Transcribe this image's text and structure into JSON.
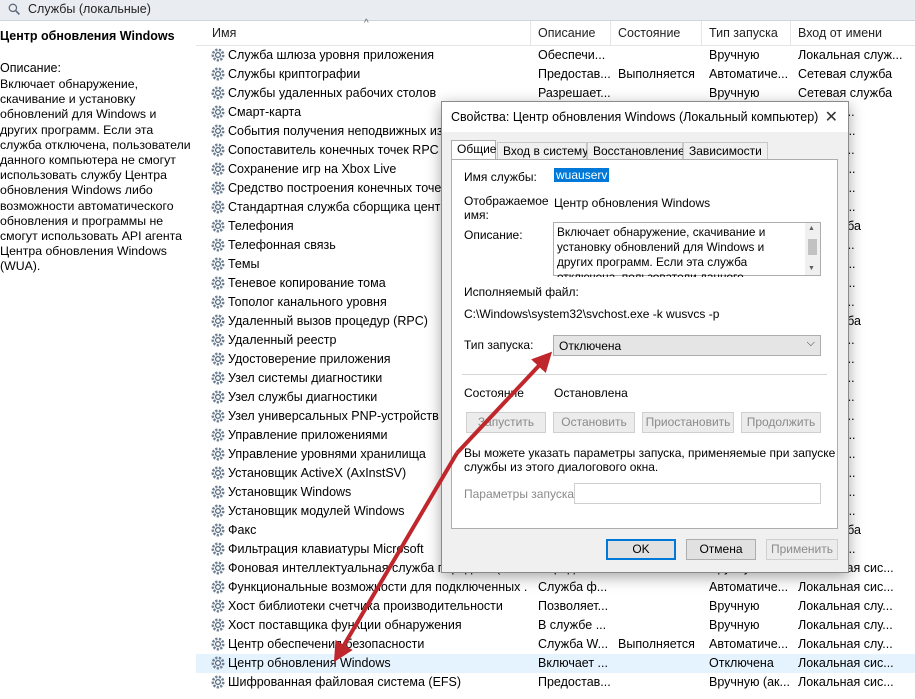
{
  "window_title": "Службы (локальные)",
  "left_pane": {
    "title": "Центр обновления Windows",
    "desc_label": "Описание:",
    "description": "Включает обнаружение, скачивание и установку обновлений для Windows и других программ. Если эта служба отключена, пользователи данного компьютера не смогут использовать службу Центра обновления Windows либо возможности автоматического обновления и программы не смогут использовать API агента Центра обновления Windows (WUA)."
  },
  "columns": [
    "Имя",
    "Описание",
    "Состояние",
    "Тип запуска",
    "Вход от имени"
  ],
  "rows": [
    {
      "name": "Служба шлюза уровня приложения",
      "desc": "Обеспечи...",
      "state": "",
      "type": "Вручную",
      "login": "Локальная служ..."
    },
    {
      "name": "Службы криптографии",
      "desc": "Предостав...",
      "state": "Выполняется",
      "type": "Автоматиче...",
      "login": "Сетевая служба"
    },
    {
      "name": "Службы удаленных рабочих столов",
      "desc": "Разрешает...",
      "state": "",
      "type": "Вручную",
      "login": "Сетевая служба"
    },
    {
      "name": "Смарт-карта",
      "desc": "",
      "state": "",
      "type": "",
      "login": "...ая слу..."
    },
    {
      "name": "События получения неподвижных изо...",
      "desc": "",
      "state": "",
      "type": "",
      "login": "...ая сис..."
    },
    {
      "name": "Сопоставитель конечных точек RPC",
      "desc": "",
      "state": "",
      "type": "",
      "login": "...ая слу..."
    },
    {
      "name": "Сохранение игр на Xbox Live",
      "desc": "",
      "state": "",
      "type": "",
      "login": "...ая сис..."
    },
    {
      "name": "Средство построения конечных точек ...",
      "desc": "",
      "state": "",
      "type": "",
      "login": "...ая сис..."
    },
    {
      "name": "Стандартная служба сборщика центра...",
      "desc": "",
      "state": "",
      "type": "",
      "login": "...ая сис..."
    },
    {
      "name": "Телефония",
      "desc": "",
      "state": "",
      "type": "",
      "login": "...я служба"
    },
    {
      "name": "Телефонная связь",
      "desc": "",
      "state": "",
      "type": "",
      "login": "...ая слу..."
    },
    {
      "name": "Темы",
      "desc": "",
      "state": "",
      "type": "",
      "login": "...ая сис..."
    },
    {
      "name": "Теневое копирование тома",
      "desc": "",
      "state": "",
      "type": "",
      "login": "...ая сис..."
    },
    {
      "name": "Тополог канального уровня",
      "desc": "",
      "state": "",
      "type": "",
      "login": "...ая слу..."
    },
    {
      "name": "Удаленный вызов процедур (RPC)",
      "desc": "",
      "state": "",
      "type": "",
      "login": "...я служба"
    },
    {
      "name": "Удаленный реестр",
      "desc": "",
      "state": "",
      "type": "",
      "login": "...ая слу..."
    },
    {
      "name": "Удостоверение приложения",
      "desc": "",
      "state": "",
      "type": "",
      "login": "...ая слу..."
    },
    {
      "name": "Узел системы диагностики",
      "desc": "",
      "state": "",
      "type": "",
      "login": "...ая слу..."
    },
    {
      "name": "Узел службы диагностики",
      "desc": "",
      "state": "",
      "type": "",
      "login": "...ая слу..."
    },
    {
      "name": "Узел универсальных PNP-устройств",
      "desc": "",
      "state": "",
      "type": "",
      "login": "...ая слу..."
    },
    {
      "name": "Управление приложениями",
      "desc": "",
      "state": "",
      "type": "",
      "login": "...ая сис..."
    },
    {
      "name": "Управление уровнями хранилища",
      "desc": "",
      "state": "",
      "type": "",
      "login": "...ая сис..."
    },
    {
      "name": "Установщик ActiveX (AxInstSV)",
      "desc": "",
      "state": "",
      "type": "",
      "login": "...ая сис..."
    },
    {
      "name": "Установщик Windows",
      "desc": "",
      "state": "",
      "type": "",
      "login": "...ая сис..."
    },
    {
      "name": "Установщик модулей Windows",
      "desc": "",
      "state": "",
      "type": "",
      "login": "...ая сис..."
    },
    {
      "name": "Факс",
      "desc": "",
      "state": "",
      "type": "",
      "login": "...я служба"
    },
    {
      "name": "Фильтрация клавиатуры Microsoft",
      "desc": "",
      "state": "",
      "type": "",
      "login": "...ая сис..."
    },
    {
      "name": "Фоновая интеллектуальная служба передачи (BITS)",
      "desc": "Передает ...",
      "state": "",
      "type": "Вручную",
      "login": "Локальная сис..."
    },
    {
      "name": "Функциональные возможности для подключенных ...",
      "desc": "Служба ф...",
      "state": "",
      "type": "Автоматиче...",
      "login": "Локальная сис..."
    },
    {
      "name": "Хост библиотеки счетчика производительности",
      "desc": "Позволяет...",
      "state": "",
      "type": "Вручную",
      "login": "Локальная слу..."
    },
    {
      "name": "Хост поставщика функции обнаружения",
      "desc": "В службе ...",
      "state": "",
      "type": "Вручную",
      "login": "Локальная слу..."
    },
    {
      "name": "Центр обеспечения безопасности",
      "desc": "Служба W...",
      "state": "Выполняется",
      "type": "Автоматиче...",
      "login": "Локальная слу..."
    },
    {
      "name": "Центр обновления Windows",
      "desc": "Включает ...",
      "state": "",
      "type": "Отключена",
      "login": "Локальная сис..."
    },
    {
      "name": "Шифрованная файловая система (EFS)",
      "desc": "Предостав...",
      "state": "",
      "type": "Вручную (ак...",
      "login": "Локальная сис..."
    }
  ],
  "dialog": {
    "title": "Свойства: Центр обновления Windows (Локальный компьютер)",
    "close": "✕",
    "tabs": [
      "Общие",
      "Вход в систему",
      "Восстановление",
      "Зависимости"
    ],
    "service_name_label": "Имя службы:",
    "service_name": "wuauserv",
    "display_name_label_1": "Отображаемое",
    "display_name_label_2": "имя:",
    "display_name": "Центр обновления Windows",
    "description_label": "Описание:",
    "description": "Включает обнаружение, скачивание и установку обновлений для Windows и других программ. Если эта служба отключена, пользователи данного компьютера не смогут использовать",
    "exe_label": "Исполняемый файл:",
    "exe_path": "C:\\Windows\\system32\\svchost.exe -k wusvcs -p",
    "startup_type_label": "Тип запуска:",
    "startup_type": "Отключена",
    "status_label": "Состояние",
    "status": "Остановлена",
    "btn_start": "Запустить",
    "btn_stop": "Остановить",
    "btn_pause": "Приостановить",
    "btn_resume": "Продолжить",
    "hint_1": "Вы можете указать параметры запуска, применяемые при запуске",
    "hint_2": "службы из этого диалогового окна.",
    "params_label": "Параметры запуска:",
    "btn_ok": "OK",
    "btn_cancel": "Отмена",
    "btn_apply": "Применить"
  },
  "arrow_color": "#c0272d"
}
